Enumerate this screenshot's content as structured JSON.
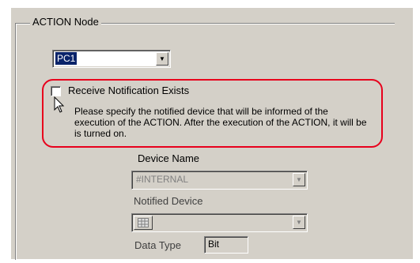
{
  "group": {
    "title": "ACTION Node"
  },
  "pc_select": {
    "value": "PC1"
  },
  "notification": {
    "checkbox_label": "Receive Notification Exists",
    "checked": false,
    "description": "Please specify the notified device that will be informed of the execution of the ACTION. After the execution of the ACTION, it will be is turned on."
  },
  "device_name": {
    "label": "Device Name",
    "value": "#INTERNAL",
    "enabled": false
  },
  "notified_device": {
    "label": "Notified Device",
    "value": "",
    "icon": "device-grid-icon",
    "enabled": false
  },
  "data_type": {
    "label": "Data Type",
    "value": "Bit"
  },
  "colors": {
    "panel": "#d4d0c8",
    "highlight": "#e8001c",
    "selection": "#0a246a"
  }
}
